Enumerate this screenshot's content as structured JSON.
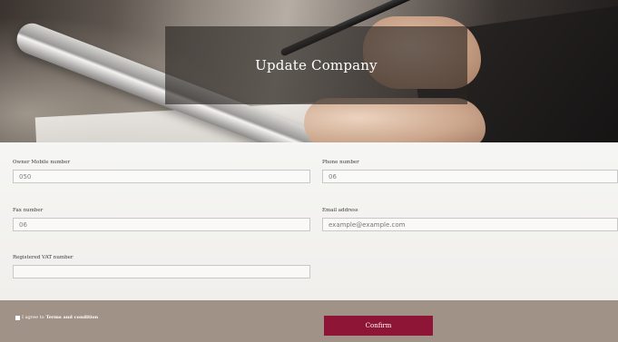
{
  "header": {
    "title": "Update Company"
  },
  "form": {
    "owner_mobile": {
      "label": "Owner Mobile number",
      "value": "050"
    },
    "phone": {
      "label": "Phone number",
      "value": "06"
    },
    "fax": {
      "label": "Fax number",
      "value": "06"
    },
    "email": {
      "label": "Email address",
      "placeholder": "example@example.com"
    },
    "vat": {
      "label": "Registered VAT number",
      "value": ""
    }
  },
  "footer": {
    "terms_prefix": "I agree to",
    "terms_link": "Terms and condition",
    "confirm_label": "Confirm"
  },
  "colors": {
    "confirm_bg": "#8f1537",
    "footer_bg": "#a09287"
  }
}
